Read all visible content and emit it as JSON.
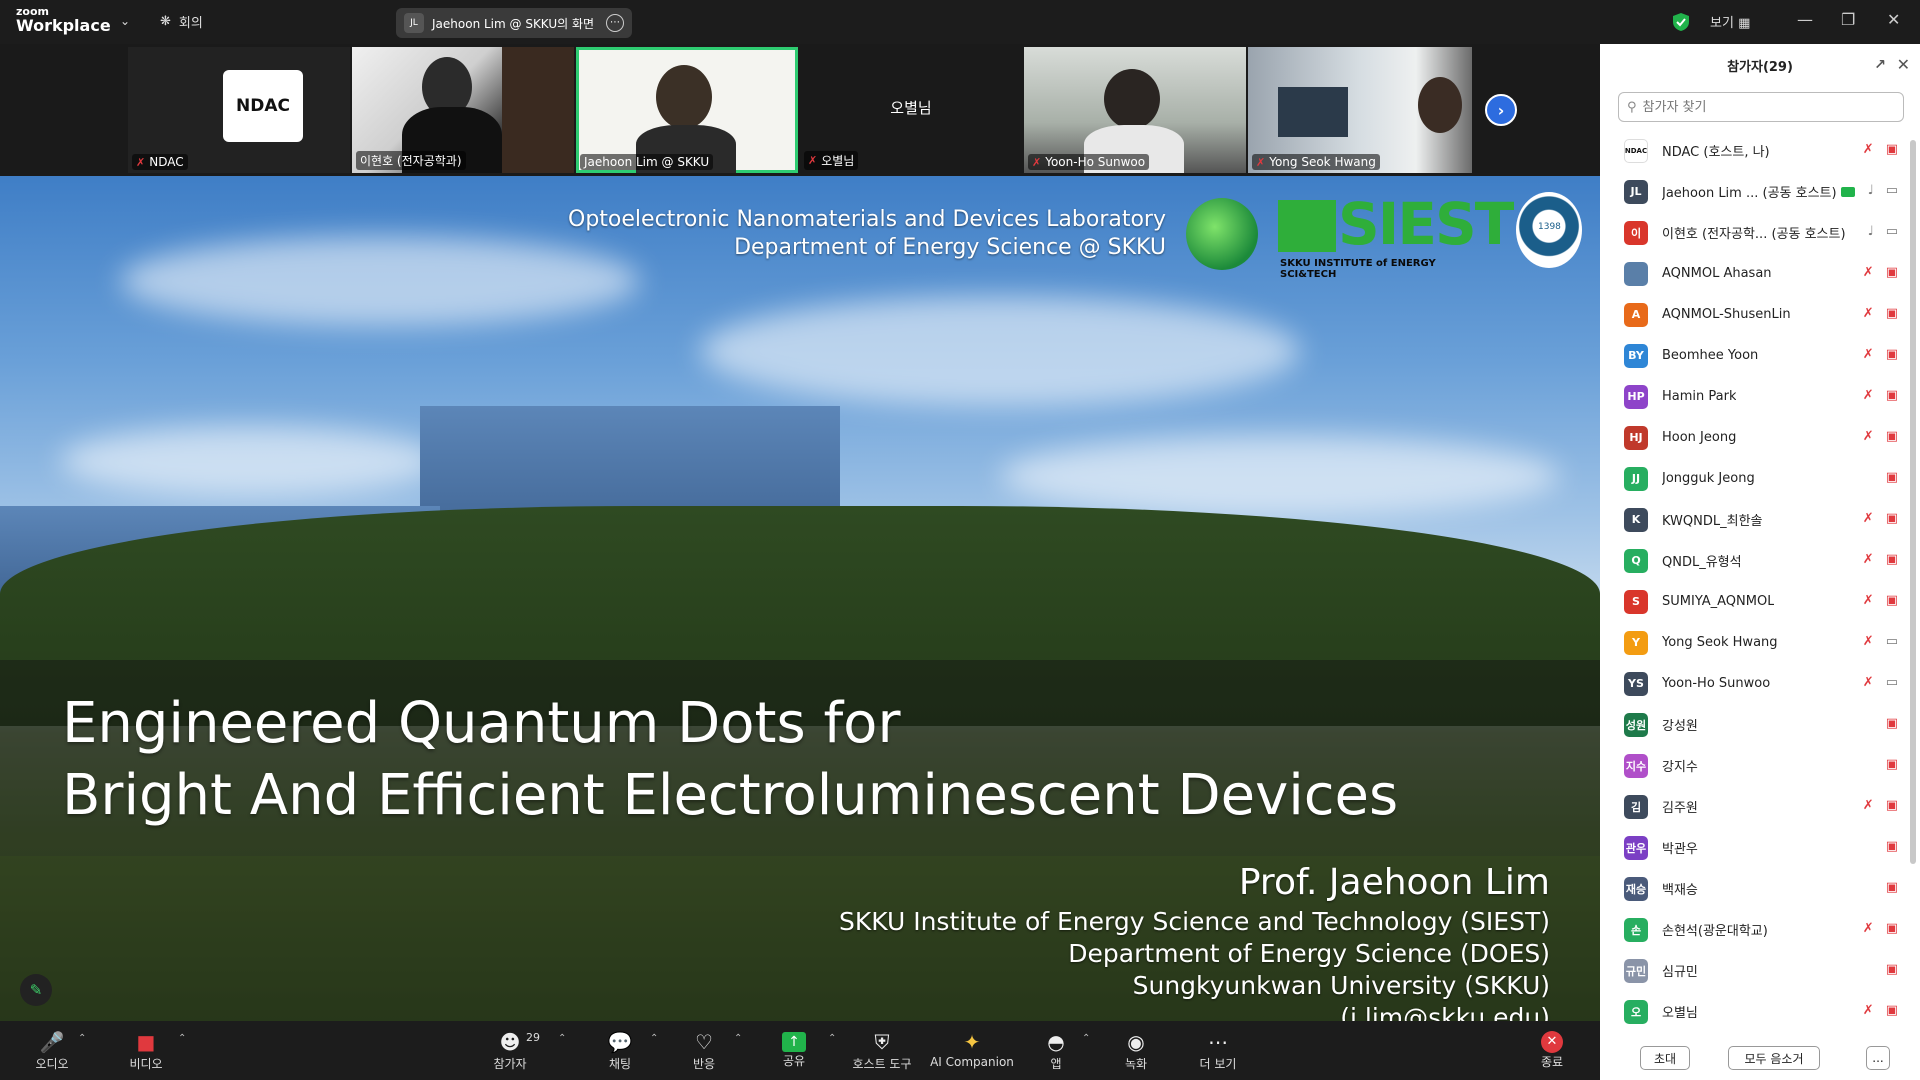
{
  "topbar": {
    "brand_small": "zoom",
    "brand_main": "Workplace",
    "meeting_label": "회의",
    "share_avatar": "JL",
    "share_label": "Jaehoon Lim @ SKKU의 화면",
    "view_label": "보기",
    "colors": {
      "shield": "#21b34b"
    }
  },
  "thumbnails": [
    {
      "name": "NDAC",
      "mic_off": true,
      "logo_text": "NDAC"
    },
    {
      "name": "이현호 (전자공학과)",
      "mic_off": false
    },
    {
      "name": "Jaehoon Lim @ SKKU",
      "mic_off": false,
      "active": true
    },
    {
      "name": "오별님",
      "mic_off": true,
      "center_name": "오별님"
    },
    {
      "name": "Yoon-Ho Sunwoo",
      "mic_off": true
    },
    {
      "name": "Yong Seok Hwang",
      "mic_off": true
    }
  ],
  "slide": {
    "lab_line1": "Optoelectronic Nanomaterials and Devices Laboratory",
    "lab_line2": "Department of Energy Science @ SKKU",
    "siest_text": "SIEST",
    "siest_sub": "SKKU INSTITUTE of ENERGY SCI&TECH",
    "emblem_text": "1398",
    "title_line1": "Engineered Quantum Dots for",
    "title_line2": "Bright And Efficient Electroluminescent Devices",
    "author_name": "Prof. Jaehoon Lim",
    "aff1": "SKKU Institute of Energy Science and Technology (SIEST)",
    "aff2": "Department of Energy Science (DOES)",
    "aff3": "Sungkyunkwan University (SKKU)",
    "email": "(j.lim@skku.edu)"
  },
  "toolbar": {
    "audio": "오디오",
    "video": "비디오",
    "participants": "참가자",
    "participants_count": "29",
    "chat": "채팅",
    "reactions": "반응",
    "share": "공유",
    "host_tools": "호스트 도구",
    "ai": "AI Companion",
    "apps": "앱",
    "record": "녹화",
    "more": "더 보기",
    "end": "종료"
  },
  "panel": {
    "title": "참가자(29)",
    "search_placeholder": "참가자 찾기",
    "invite": "초대",
    "mute_all": "모두 음소거",
    "more": "...",
    "participants": [
      {
        "initials": "NDAC",
        "name": "NDAC (호스트, 나)",
        "color": "#ffffff",
        "mic": "off",
        "video": "off"
      },
      {
        "initials": "JL",
        "name": "Jaehoon Lim ... (공동 호스트)",
        "color": "#3d4a5c",
        "mic": "on",
        "video": "on",
        "sharing": true
      },
      {
        "initials": "이",
        "name": "이현호 (전자공학... (공동 호스트)",
        "color": "#d9362b",
        "mic": "on",
        "video": "on"
      },
      {
        "initials": "",
        "name": "AQNMOL  Ahasan",
        "color": "#5a7fa8",
        "mic": "off",
        "video": "off"
      },
      {
        "initials": "A",
        "name": "AQNMOL-ShusenLin",
        "color": "#e86a1a",
        "mic": "off",
        "video": "off"
      },
      {
        "initials": "BY",
        "name": "Beomhee Yoon",
        "color": "#2e86d6",
        "mic": "off",
        "video": "off"
      },
      {
        "initials": "HP",
        "name": "Hamin Park",
        "color": "#8e44c9",
        "mic": "off",
        "video": "off"
      },
      {
        "initials": "HJ",
        "name": "Hoon Jeong",
        "color": "#c0392b",
        "mic": "off",
        "video": "off"
      },
      {
        "initials": "JJ",
        "name": "Jongguk Jeong",
        "color": "#27ae60",
        "mic": "",
        "video": "off"
      },
      {
        "initials": "K",
        "name": "KWQNDL_최한솔",
        "color": "#3d4a5c",
        "mic": "off",
        "video": "off"
      },
      {
        "initials": "Q",
        "name": "QNDL_유형석",
        "color": "#27ae60",
        "mic": "off",
        "video": "off"
      },
      {
        "initials": "S",
        "name": "SUMIYA_AQNMOL",
        "color": "#d9362b",
        "mic": "off",
        "video": "off"
      },
      {
        "initials": "Y",
        "name": "Yong Seok Hwang",
        "color": "#f39c12",
        "mic": "off",
        "video": "on"
      },
      {
        "initials": "YS",
        "name": "Yoon-Ho Sunwoo",
        "color": "#3d4a5c",
        "mic": "off",
        "video": "on"
      },
      {
        "initials": "성원",
        "name": "강성원",
        "color": "#1e7a4a",
        "mic": "",
        "video": "off"
      },
      {
        "initials": "지수",
        "name": "강지수",
        "color": "#b04fc9",
        "mic": "",
        "video": "off"
      },
      {
        "initials": "김",
        "name": "김주원",
        "color": "#3d4a5c",
        "mic": "off",
        "video": "off"
      },
      {
        "initials": "관우",
        "name": "박관우",
        "color": "#7b3fc4",
        "mic": "",
        "video": "off"
      },
      {
        "initials": "재승",
        "name": "백재승",
        "color": "#4a5a7a",
        "mic": "",
        "video": "off"
      },
      {
        "initials": "손",
        "name": "손현석(광운대학교)",
        "color": "#27ae60",
        "mic": "off",
        "video": "off"
      },
      {
        "initials": "규민",
        "name": "심규민",
        "color": "#8a94a8",
        "mic": "",
        "video": "off"
      },
      {
        "initials": "오",
        "name": "오별님",
        "color": "#27ae60",
        "mic": "off",
        "video": "off"
      }
    ]
  }
}
